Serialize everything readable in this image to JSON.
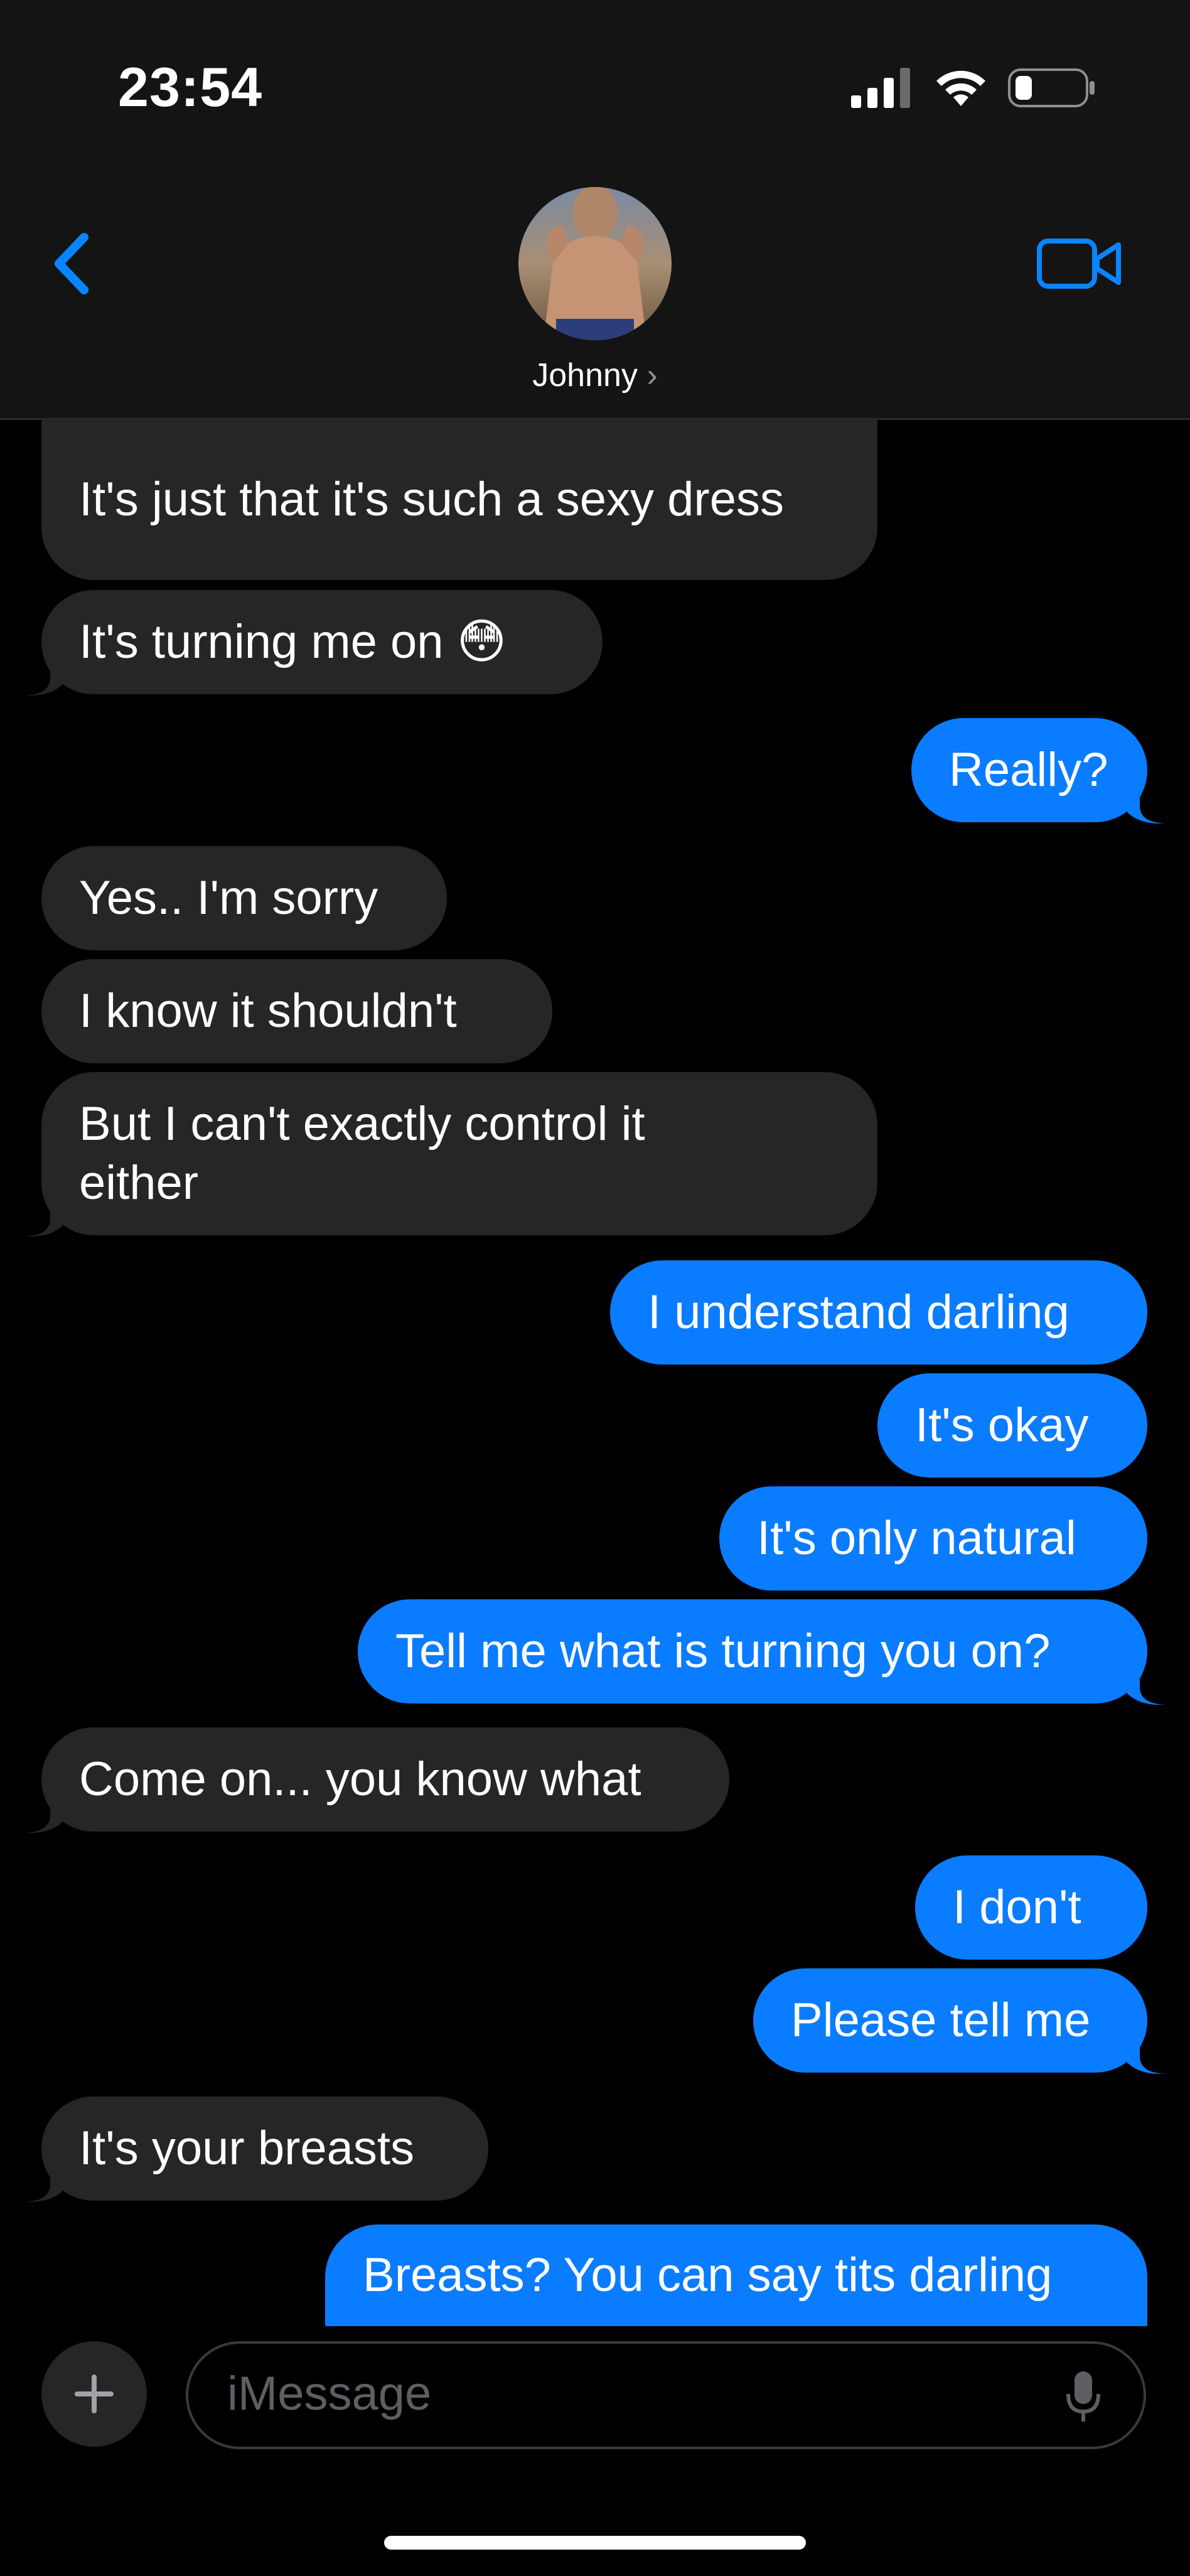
{
  "status_bar": {
    "time": "23:54"
  },
  "header": {
    "contact_name": "Johnny"
  },
  "messages": [
    {
      "text": "It's just that it's such a sexy dress"
    },
    {
      "text": "It's turning me on 😳"
    },
    {
      "text": "Really?"
    },
    {
      "text": "Yes.. I'm sorry"
    },
    {
      "text": "I know it shouldn't"
    },
    {
      "text": "But I can't exactly control it either"
    },
    {
      "text": "I understand darling"
    },
    {
      "text": "It's okay"
    },
    {
      "text": "It's only natural"
    },
    {
      "text": "Tell me what is turning you on?"
    },
    {
      "text": "Come on... you know what"
    },
    {
      "text": "I don't"
    },
    {
      "text": "Please tell me"
    },
    {
      "text": "It's your breasts"
    },
    {
      "text": "Breasts? You can say tits darling"
    }
  ],
  "input": {
    "placeholder": "iMessage"
  },
  "colors": {
    "sent": "#0a7cff",
    "received": "#262628",
    "accent": "#0a84ff"
  },
  "icons": [
    "back-chevron-icon",
    "video-call-icon",
    "signal-icon",
    "wifi-icon",
    "battery-icon",
    "plus-icon",
    "microphone-icon"
  ]
}
